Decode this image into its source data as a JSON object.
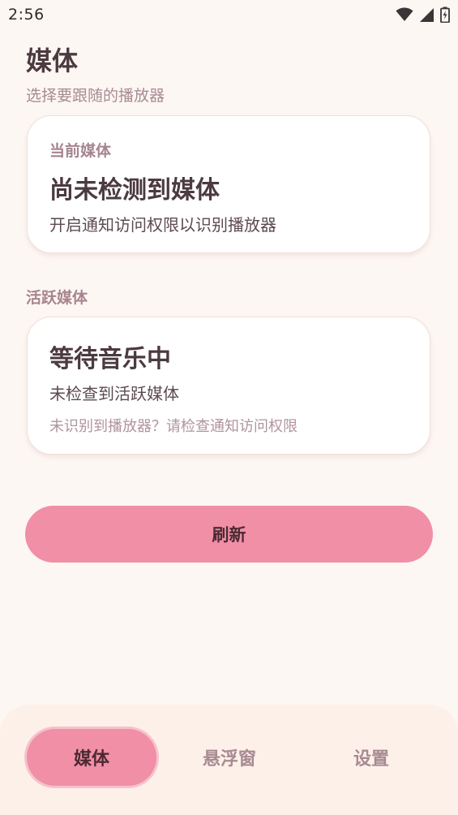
{
  "status_bar": {
    "time": "2:56"
  },
  "header": {
    "title": "媒体",
    "subtitle": "选择要跟随的播放器"
  },
  "current_media": {
    "label": "当前媒体",
    "heading": "尚未检测到媒体",
    "text": "开启通知访问权限以识别播放器"
  },
  "active_media": {
    "section_label": "活跃媒体",
    "heading": "等待音乐中",
    "text": "未检查到活跃媒体",
    "hint": "未识别到播放器？请检查通知访问权限"
  },
  "refresh_label": "刷新",
  "bottom_nav": {
    "items": [
      {
        "label": "媒体",
        "active": true
      },
      {
        "label": "悬浮窗",
        "active": false
      },
      {
        "label": "设置",
        "active": false
      }
    ]
  },
  "colors": {
    "background": "#fdf7f3",
    "accent": "#f08fa6",
    "card": "#ffffff",
    "nav_background": "#fdf0e8",
    "muted_text": "#a88a93",
    "primary_text": "#4b3a40"
  },
  "icons": [
    "wifi-icon",
    "cellular-signal-icon",
    "battery-charging-icon"
  ]
}
